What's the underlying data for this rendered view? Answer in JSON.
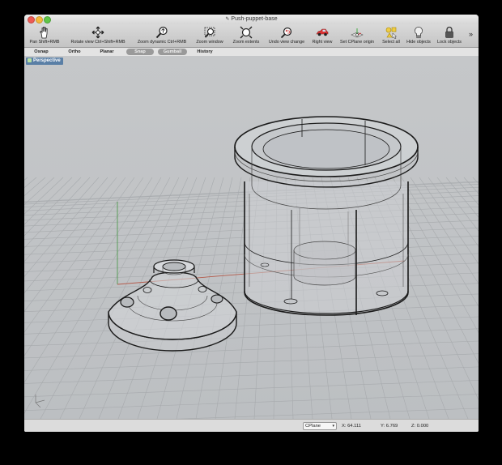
{
  "window": {
    "title": "Push-puppet-base"
  },
  "toolbar": {
    "items": [
      {
        "label": "Pan  Shift+RMB",
        "icon": "hand-icon"
      },
      {
        "label": "Rotate view  Ctrl+Shift+RMB",
        "icon": "rotate-view-icon"
      },
      {
        "label": "Zoom dynamic  Ctrl+RMB",
        "icon": "zoom-dynamic-icon"
      },
      {
        "label": "Zoom window",
        "icon": "zoom-window-icon"
      },
      {
        "label": "Zoom extents",
        "icon": "zoom-extents-icon"
      },
      {
        "label": "Undo view change",
        "icon": "undo-view-icon"
      },
      {
        "label": "Right view",
        "icon": "right-view-icon"
      },
      {
        "label": "Set CPlane origin",
        "icon": "cplane-origin-icon"
      },
      {
        "label": "Select all",
        "icon": "select-all-icon"
      },
      {
        "label": "Hide objects",
        "icon": "hide-objects-icon"
      },
      {
        "label": "Lock objects",
        "icon": "lock-objects-icon"
      }
    ],
    "overflow": "»"
  },
  "modes": {
    "osnap": "Osnap",
    "ortho": "Ortho",
    "planar": "Planar",
    "snap": "Snap",
    "gumball": "Gumball",
    "history": "History"
  },
  "viewport": {
    "name": "Perspective"
  },
  "status": {
    "cplane": "CPlane",
    "x": "X: 64.111",
    "y": "Y: 6.769",
    "z": "Z: 0.000"
  },
  "colors": {
    "viewport_bg": "#c0c3c6",
    "grid": "#a7aaad",
    "x_axis": "#b45a4a",
    "y_axis": "#4f9a4f",
    "viewport_tab": "#5a7fa6"
  }
}
